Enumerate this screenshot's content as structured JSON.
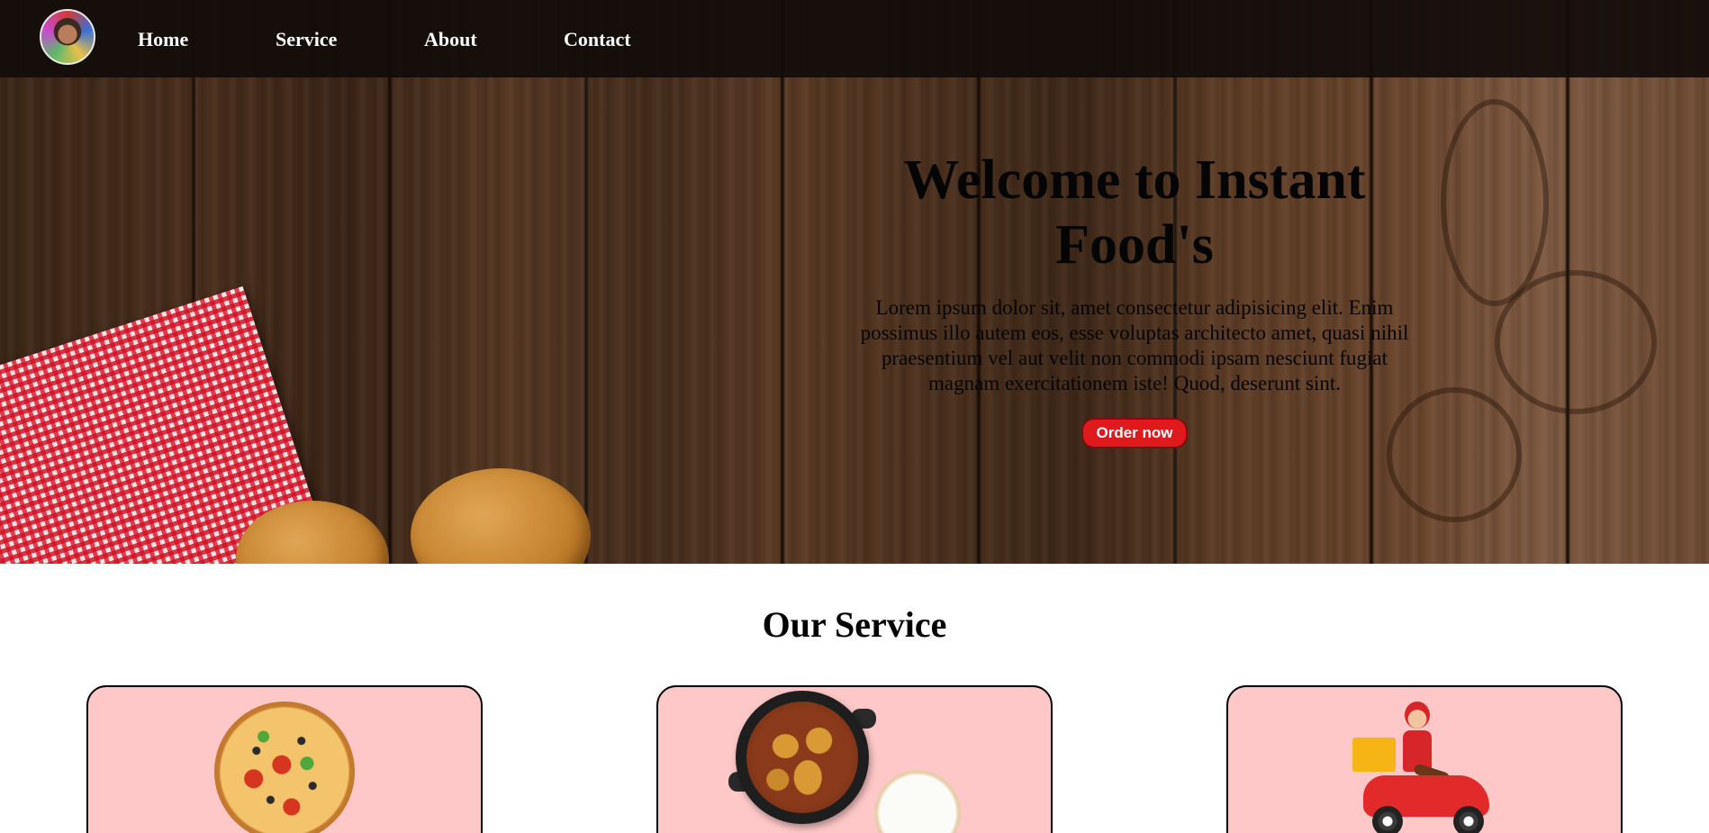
{
  "nav": {
    "items": [
      "Home",
      "Service",
      "About",
      "Contact"
    ]
  },
  "hero": {
    "title": "Welcome to Instant Food's",
    "text": "Lorem ipsum dolor sit, amet consectetur adipisicing elit. Enim possimus illo autem eos, esse voluptas architecto amet, quasi nihil praesentium vel aut velit non commodi ipsam nesciunt fugiat magnam exercitationem iste! Quod, deserunt sint.",
    "button": "Order now"
  },
  "service": {
    "title": "Our Service",
    "cards": [
      {
        "image": "pizza-image"
      },
      {
        "image": "curry-rice-image"
      },
      {
        "image": "delivery-scooter-image"
      }
    ]
  },
  "colors": {
    "navbar": "#120c0a",
    "order_button": "#e0191d",
    "card_background": "#ffc8c8"
  }
}
